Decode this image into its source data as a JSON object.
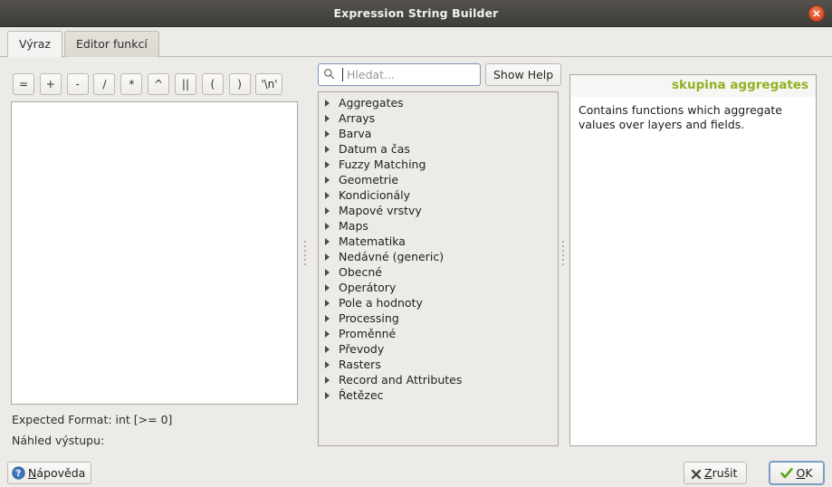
{
  "window": {
    "title": "Expression String Builder",
    "close_icon": "close-circle-icon"
  },
  "tabs": [
    {
      "label": "Výraz",
      "active": true
    },
    {
      "label": "Editor funkcí",
      "active": false
    }
  ],
  "operators": [
    {
      "label": "=",
      "name": "equals"
    },
    {
      "label": "+",
      "name": "plus"
    },
    {
      "label": "-",
      "name": "minus"
    },
    {
      "label": "/",
      "name": "divide"
    },
    {
      "label": "*",
      "name": "multiply"
    },
    {
      "label": "^",
      "name": "power"
    },
    {
      "label": "||",
      "name": "concat"
    },
    {
      "label": "(",
      "name": "open-paren"
    },
    {
      "label": ")",
      "name": "close-paren"
    },
    {
      "label": "'\\n'",
      "name": "newline"
    }
  ],
  "expression": {
    "value": "",
    "expected_format": "Expected Format: int [>= 0]",
    "preview_label": "Náhled výstupu:",
    "preview_value": ""
  },
  "search": {
    "value": "",
    "placeholder": "Hledat...",
    "icon": "search-icon"
  },
  "show_help_button": {
    "label": "Show Help"
  },
  "function_tree": [
    {
      "label": "Aggregates"
    },
    {
      "label": "Arrays"
    },
    {
      "label": "Barva"
    },
    {
      "label": "Datum a čas"
    },
    {
      "label": "Fuzzy Matching"
    },
    {
      "label": "Geometrie"
    },
    {
      "label": "Kondicionály"
    },
    {
      "label": "Mapové vrstvy"
    },
    {
      "label": "Maps"
    },
    {
      "label": "Matematika"
    },
    {
      "label": "Nedávné (generic)"
    },
    {
      "label": "Obecné"
    },
    {
      "label": "Operátory"
    },
    {
      "label": "Pole a hodnoty"
    },
    {
      "label": "Processing"
    },
    {
      "label": "Proměnné"
    },
    {
      "label": "Převody"
    },
    {
      "label": "Rasters"
    },
    {
      "label": "Record and Attributes"
    },
    {
      "label": "Řetězec"
    }
  ],
  "help": {
    "title": "skupina aggregates",
    "body": "Contains functions which aggregate values over layers and fields.",
    "title_color": "#93b023"
  },
  "buttons": {
    "help": {
      "label": "Nápověda",
      "accel": "N",
      "icon": "question-circle-icon"
    },
    "cancel": {
      "label": "Zrušit",
      "accel": "Z",
      "icon": "cross-icon"
    },
    "ok": {
      "label": "OK",
      "accel": "O",
      "icon": "checkmark-icon"
    }
  }
}
